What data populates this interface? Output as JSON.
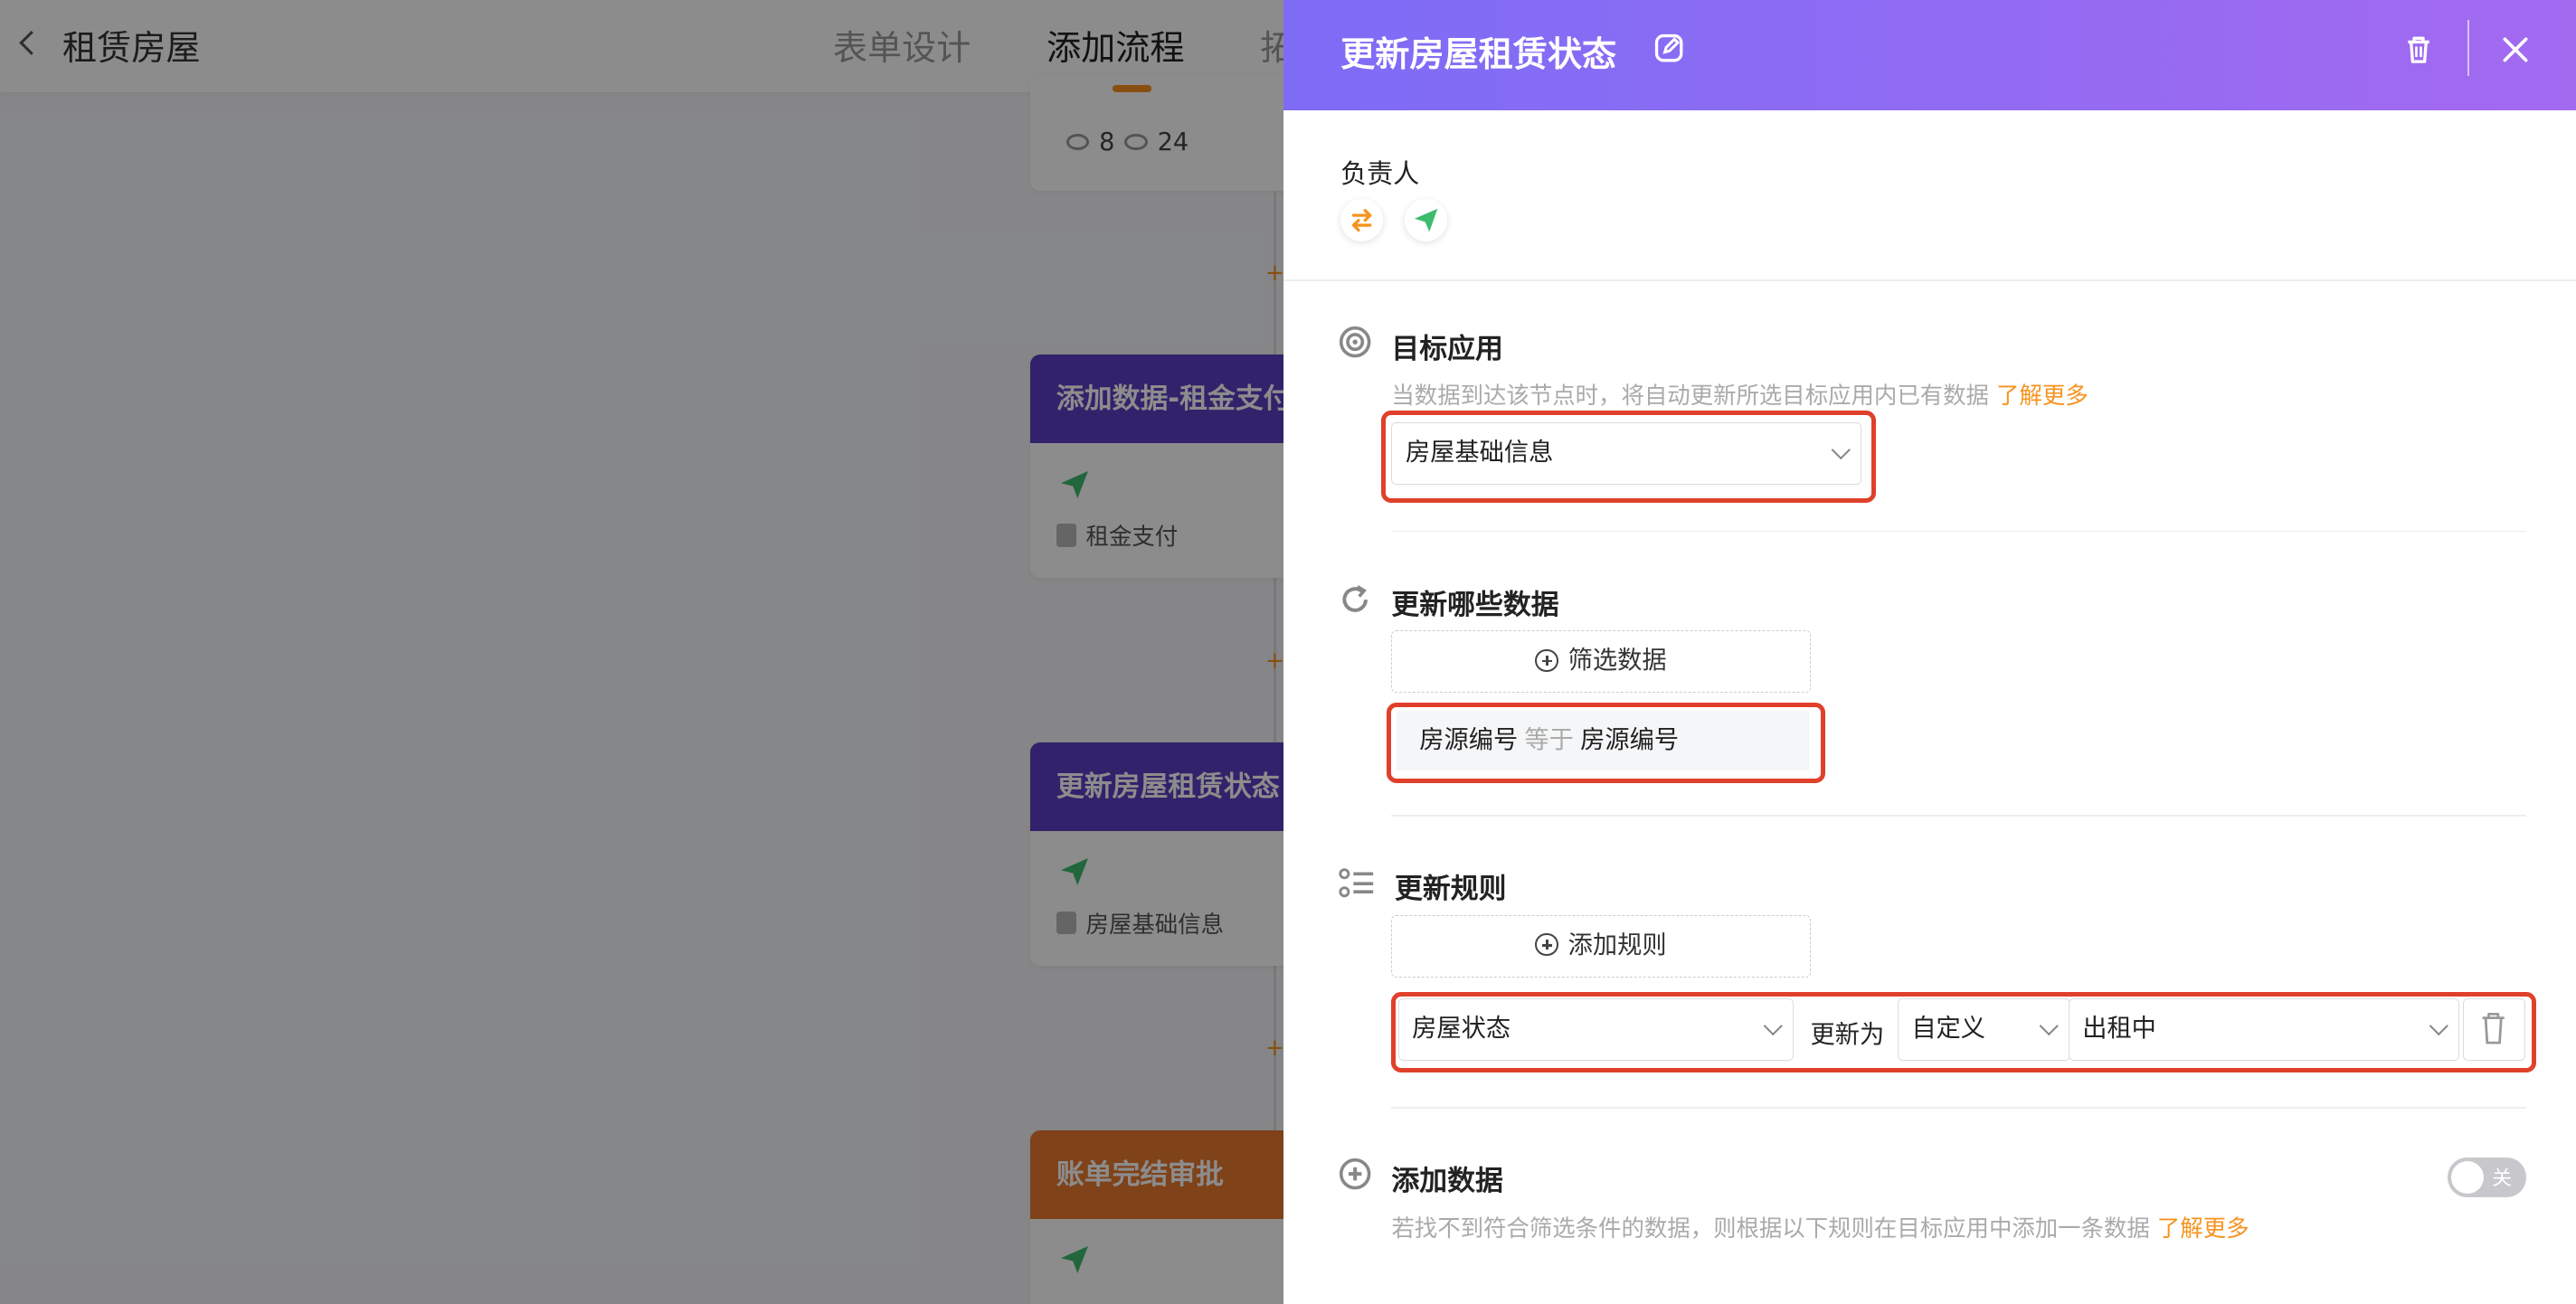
{
  "topbar": {
    "title": "租赁房屋",
    "tabs": [
      {
        "label": "表单设计",
        "active": false
      },
      {
        "label": "添加流程",
        "active": true
      },
      {
        "label": "拓",
        "active": false
      }
    ]
  },
  "canvas": {
    "top_card": {
      "views_a": "8",
      "views_b": "24"
    },
    "cards": [
      {
        "title": "添加数据-租金支付",
        "target": "租金支付",
        "color": "#5b3fc4"
      },
      {
        "title": "更新房屋租赁状态",
        "target": "房屋基础信息",
        "color": "#5b3fc4"
      },
      {
        "title": "账单完结审批",
        "target": "",
        "color": "#e8782e"
      }
    ]
  },
  "drawer": {
    "title": "更新房屋租赁状态",
    "owner_label": "负责人",
    "target_app": {
      "title": "目标应用",
      "desc": "当数据到达该节点时，将自动更新所选目标应用内已有数据",
      "learn_more": "了解更多",
      "selected": "房屋基础信息"
    },
    "which_data": {
      "title": "更新哪些数据",
      "filter_button": "筛选数据",
      "condition": {
        "field": "房源编号",
        "op": "等于",
        "value": "房源编号"
      }
    },
    "rules": {
      "title": "更新规则",
      "add_button": "添加规则",
      "rule": {
        "field": "房屋状态",
        "update_to": "更新为",
        "mode": "自定义",
        "value": "出租中"
      }
    },
    "add_data": {
      "title": "添加数据",
      "desc": "若找不到符合筛选条件的数据，则根据以下规则在目标应用中添加一条数据",
      "learn_more": "了解更多",
      "toggle_label": "关",
      "toggle_on": false
    }
  },
  "colors": {
    "accent": "#f7931e",
    "highlight": "#e0402a",
    "header_start": "#7d6cf6",
    "header_end": "#a36af0",
    "send_green": "#3dbb6e"
  }
}
